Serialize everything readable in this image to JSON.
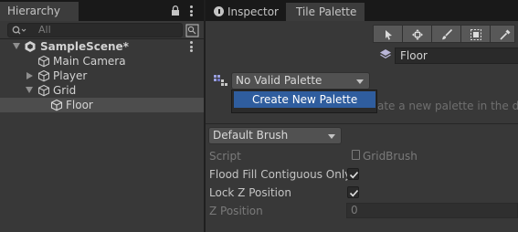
{
  "hierarchy": {
    "tab_label": "Hierarchy",
    "search": {
      "placeholder": "All"
    },
    "tree": [
      {
        "label": "SampleScene*",
        "level": 0,
        "expanded": true,
        "icon": "unity-scene-icon"
      },
      {
        "label": "Main Camera",
        "level": 1,
        "icon": "gameobject-cube-icon"
      },
      {
        "label": "Player",
        "level": 1,
        "collapsed": true,
        "icon": "gameobject-cube-icon"
      },
      {
        "label": "Grid",
        "level": 1,
        "expanded": true,
        "icon": "gameobject-cube-icon"
      },
      {
        "label": "Floor",
        "level": 2,
        "selected": true,
        "icon": "gameobject-cube-icon"
      }
    ]
  },
  "right_panel": {
    "tabs": [
      {
        "label": "Inspector",
        "icon": "info-icon",
        "active": false
      },
      {
        "label": "Tile Palette",
        "active": true
      }
    ],
    "toolbar": [
      "select-tool",
      "move-tool",
      "paint-brush-tool",
      "box-fill-tool",
      "picker-tool"
    ],
    "active_target": "Floor",
    "palette_dropdown": {
      "selected": "No Valid Palette",
      "menu_items": [
        "Create New Palette"
      ]
    },
    "empty_hint_text": "ate a new palette in the dro",
    "brush_dropdown": {
      "selected": "Default Brush"
    },
    "properties": {
      "script_label": "Script",
      "script_value": "GridBrush",
      "flood_fill_label": "Flood Fill Contiguous Only",
      "flood_fill_checked": true,
      "lock_z_label": "Lock Z Position",
      "lock_z_checked": true,
      "z_position_label": "Z Position",
      "z_position_value": "0"
    }
  },
  "colors": {
    "panel_bg": "#383838",
    "tabbar_bg": "#191919",
    "selection": "#4d4d4d",
    "menu_highlight": "#2f5d9e"
  }
}
